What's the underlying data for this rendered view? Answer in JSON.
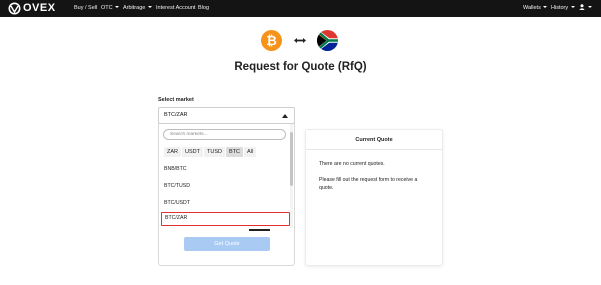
{
  "nav": {
    "logo_text": "OVEX",
    "items": [
      {
        "label": "Buy / Sell"
      },
      {
        "label": "OTC"
      },
      {
        "label": "Arbitrage"
      },
      {
        "label": "Interest Account"
      },
      {
        "label": "Blog"
      }
    ],
    "right": [
      {
        "label": "Wallets"
      },
      {
        "label": "History"
      }
    ],
    "user_icon": "user-icon"
  },
  "hero": {
    "base_icon": "bitcoin-icon",
    "base_symbol": "₿",
    "arrow_icon": "swap-arrow-icon",
    "quote_icon": "south-africa-flag-icon",
    "title": "Request for Quote (RfQ)"
  },
  "form": {
    "select_label": "Select market",
    "selected_market": "BTC/ZAR",
    "search_placeholder": "Search markets...",
    "filters": [
      "ZAR",
      "USDT",
      "TUSD",
      "BTC",
      "All"
    ],
    "active_filter": "BTC",
    "markets": [
      "BNB/BTC",
      "BTC/TUSD",
      "BTC/USDT",
      "BTC/ZAR"
    ],
    "get_quote_label": "Get Quote"
  },
  "quote": {
    "title": "Current Quote",
    "empty_text": "There are no current quotes.",
    "hint_text": "Please fill out the request form to receive a quote."
  },
  "colors": {
    "nav_bg": "#141414",
    "bitcoin": "#f7931a",
    "button_disabled": "#a9cbf3",
    "selected_outline": "#e03030"
  }
}
